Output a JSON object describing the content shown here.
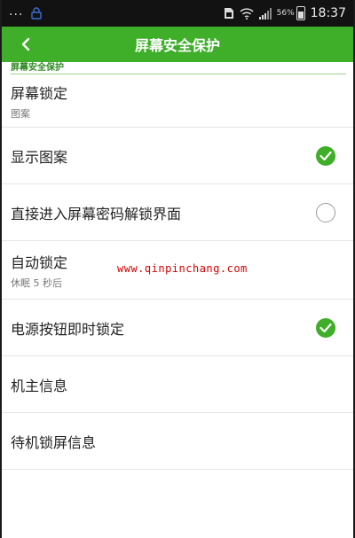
{
  "status_bar": {
    "dots": "...",
    "battery_percent": "56%",
    "time": "18:37",
    "icons": [
      "lock-icon",
      "sim-icon",
      "wifi-icon",
      "signal-icon",
      "battery-icon"
    ]
  },
  "header": {
    "title": "屏幕安全保护",
    "back_icon": "chevron-left-icon"
  },
  "section": {
    "title": "屏幕安全保护"
  },
  "settings": [
    {
      "label": "屏幕锁定",
      "sub": "图案"
    },
    {
      "label": "显示图案",
      "checked": true
    },
    {
      "label": "直接进入屏幕密码解锁界面",
      "checked": false
    },
    {
      "label": "自动锁定",
      "sub": "休眠 5 秒后"
    },
    {
      "label": "电源按钮即时锁定",
      "checked": true
    },
    {
      "label": "机主信息"
    },
    {
      "label": "待机锁屏信息"
    }
  ],
  "watermark": "www.qinpinchang.com",
  "colors": {
    "accent": "#3fae29",
    "status_bar": "#121212",
    "watermark": "#d40000"
  }
}
